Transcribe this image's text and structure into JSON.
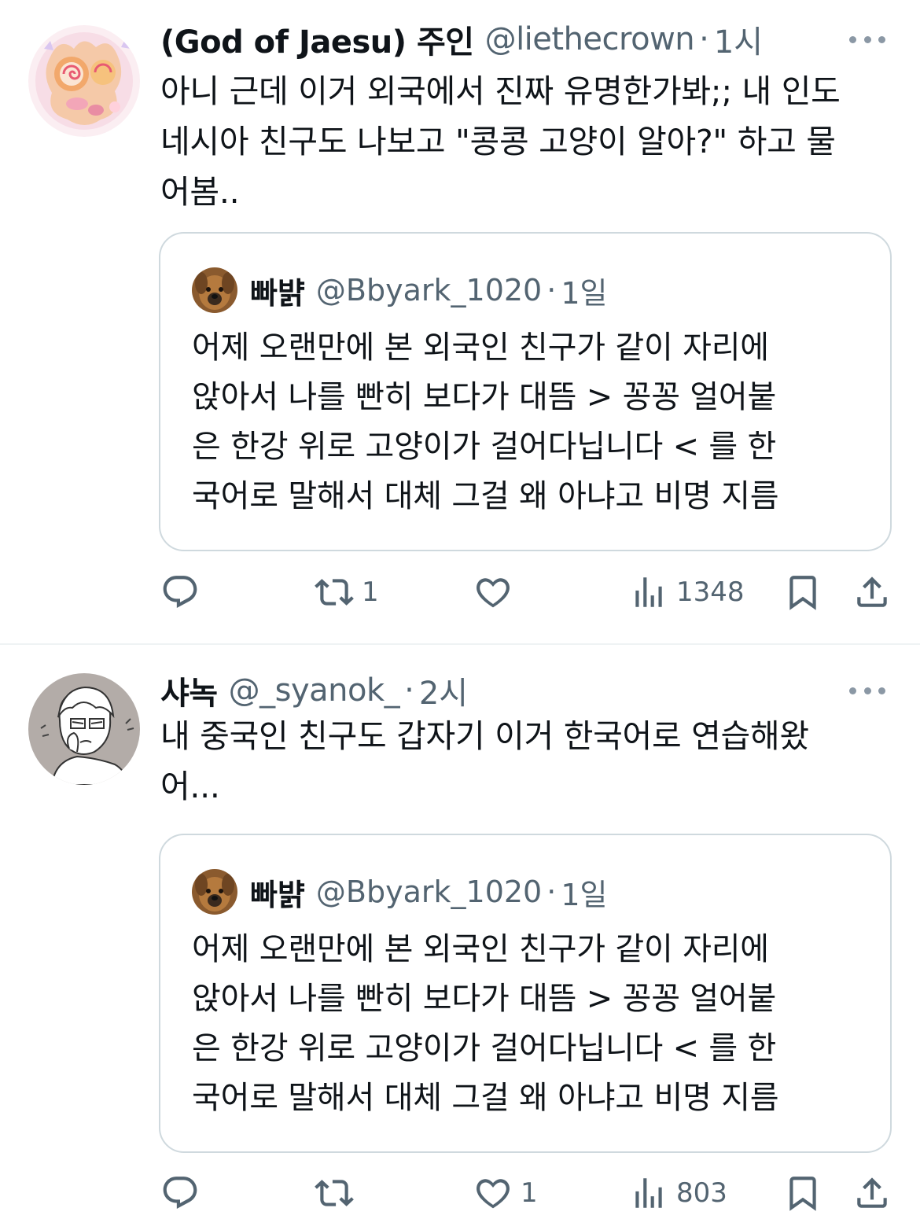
{
  "tweets": [
    {
      "author": {
        "name": "(God of Jaesu) 주인",
        "handle": "@liethecrown",
        "time": "1시",
        "avatar_icon": "pastel-cookie-avatar"
      },
      "text": "아니 근데 이거 외국에서 진짜 유명한가봐;; 내 인도\n네시아 친구도 나보고 \"콩콩 고양이 알아?\" 하고 물\n어봄..",
      "quote": {
        "author": {
          "name": "빠뱕",
          "handle": "@Bbyark_1020",
          "time": "1일",
          "avatar_icon": "dog-avatar"
        },
        "text": "어제 오랜만에 본 외국인 친구가 같이 자리에\n앉아서 나를 빤히 보다가 대뜸 > 꽁꽁 얼어붙\n은 한강 위로 고양이가 걸어다닙니다 < 를 한\n국어로 말해서 대체 그걸 왜 아냐고 비명 지름"
      },
      "actions": {
        "replies": "",
        "retweets": "1",
        "likes": "",
        "views": "1348"
      }
    },
    {
      "author": {
        "name": "샤녹",
        "handle": "@_syanok_",
        "time": "2시",
        "avatar_icon": "sketch-boy-avatar"
      },
      "text": "내 중국인 친구도 갑자기 이거 한국어로 연습해왔\n어...",
      "quote": {
        "author": {
          "name": "빠뱕",
          "handle": "@Bbyark_1020",
          "time": "1일",
          "avatar_icon": "dog-avatar"
        },
        "text": "어제 오랜만에 본 외국인 친구가 같이 자리에\n앉아서 나를 빤히 보다가 대뜸 > 꽁꽁 얼어붙\n은 한강 위로 고양이가 걸어다닙니다 < 를 한\n국어로 말해서 대체 그걸 왜 아냐고 비명 지름"
      },
      "actions": {
        "replies": "",
        "retweets": "",
        "likes": "1",
        "views": "803"
      }
    }
  ],
  "colors": {
    "text": "#0f1419",
    "secondary": "#536471",
    "border": "#cfd9de",
    "divider": "#eff3f4"
  },
  "icons": [
    "reply-icon",
    "retweet-icon",
    "like-icon",
    "views-icon",
    "bookmark-icon",
    "share-icon",
    "more-icon"
  ]
}
